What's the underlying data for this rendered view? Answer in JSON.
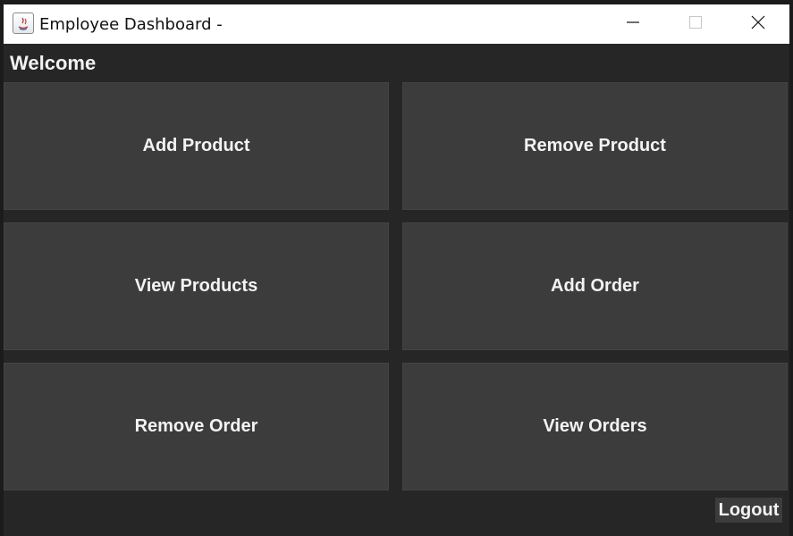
{
  "window": {
    "title": "Employee Dashboard -"
  },
  "header": {
    "welcome": "Welcome"
  },
  "actions": {
    "add_product": "Add Product",
    "remove_product": "Remove Product",
    "view_products": "View Products",
    "add_order": "Add Order",
    "remove_order": "Remove Order",
    "view_orders": "View Orders"
  },
  "footer": {
    "logout": "Logout"
  },
  "icons": {
    "app": "java-icon",
    "minimize": "minimize-icon",
    "maximize": "maximize-icon",
    "close": "close-icon"
  },
  "colors": {
    "background": "#262626",
    "tile": "#3c3c3c",
    "text": "#f3f3f3",
    "titlebar": "#ffffff"
  }
}
